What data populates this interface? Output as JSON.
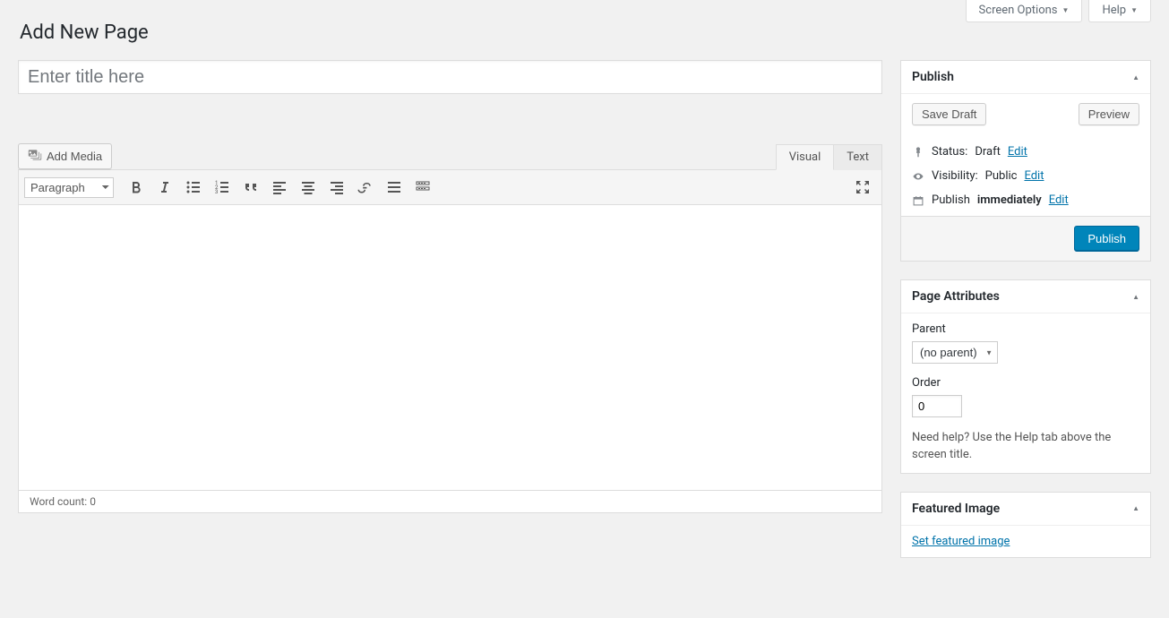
{
  "screen_meta": {
    "screen_options_label": "Screen Options",
    "help_label": "Help"
  },
  "page_title": "Add New Page",
  "title_field": {
    "placeholder": "Enter title here",
    "value": ""
  },
  "media": {
    "add_media_label": "Add Media"
  },
  "editor": {
    "tab_visual": "Visual",
    "tab_text": "Text",
    "format_selected": "Paragraph",
    "word_count_label": "Word count:",
    "word_count": "0"
  },
  "publish": {
    "title": "Publish",
    "save_draft": "Save Draft",
    "preview": "Preview",
    "status_label": "Status:",
    "status_value": "Draft",
    "visibility_label": "Visibility:",
    "visibility_value": "Public",
    "schedule_label": "Publish",
    "schedule_value": "immediately",
    "edit_label": "Edit",
    "publish_button": "Publish"
  },
  "page_attributes": {
    "title": "Page Attributes",
    "parent_label": "Parent",
    "parent_selected": "(no parent)",
    "order_label": "Order",
    "order_value": "0",
    "help_text": "Need help? Use the Help tab above the screen title."
  },
  "featured_image": {
    "title": "Featured Image",
    "link_label": "Set featured image"
  }
}
